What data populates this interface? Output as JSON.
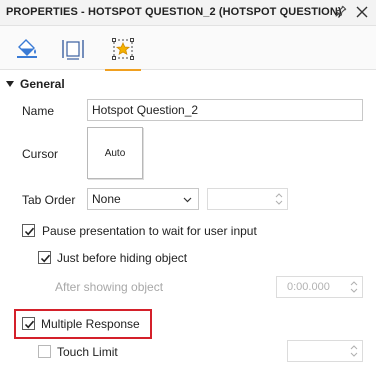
{
  "panel": {
    "title": "PROPERTIES - HOTSPOT QUESTION_2 (HOTSPOT QUESTION)"
  },
  "tabs": [
    {
      "name": "style-tab",
      "icon": "paint-bucket-icon"
    },
    {
      "name": "size-tab",
      "icon": "size-position-icon"
    },
    {
      "name": "actions-tab",
      "icon": "star-selection-icon",
      "active": true
    }
  ],
  "general": {
    "section_label": "General",
    "name_label": "Name",
    "name_value": "Hotspot Question_2",
    "cursor_label": "Cursor",
    "cursor_value": "Auto",
    "tab_order_label": "Tab Order",
    "tab_order_value": "None",
    "pause_label": "Pause presentation to wait for user input",
    "pause_checked": true,
    "before_hiding_label": "Just before hiding object",
    "before_hiding_checked": true,
    "after_showing_label": "After showing object",
    "after_showing_value": "0:00.000",
    "multiple_response_label": "Multiple Response",
    "multiple_response_checked": true,
    "touch_limit_label": "Touch Limit",
    "touch_limit_checked": false
  },
  "colors": {
    "highlight_border": "#d4202a",
    "active_tab_indicator": "#f0a020"
  }
}
